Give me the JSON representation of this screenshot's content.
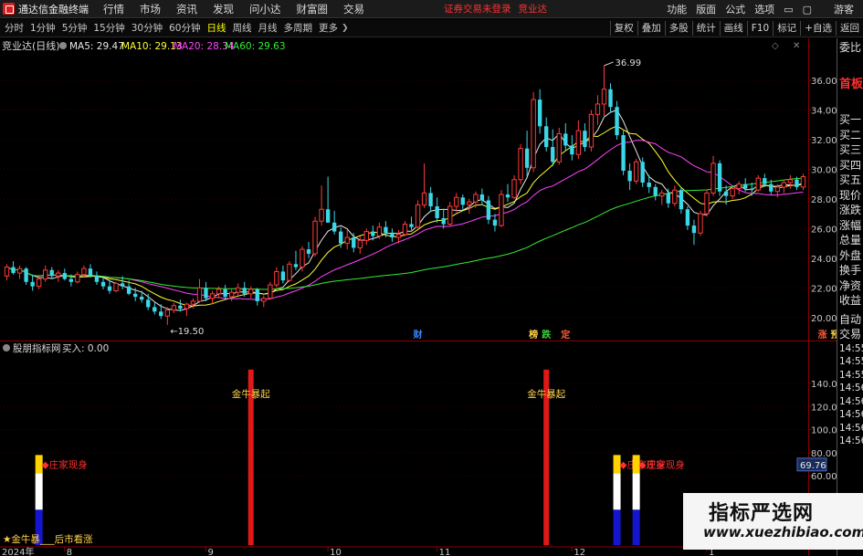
{
  "menubar": {
    "app_title": "通达信金融终端",
    "items": [
      "行情",
      "市场",
      "资讯",
      "发现",
      "问小达",
      "财富圈",
      "交易"
    ],
    "warning": "证券交易未登录",
    "warning_link": "竞业达",
    "right_items": [
      "功能",
      "版面",
      "公式",
      "选项"
    ],
    "user": "游客"
  },
  "toolbar": {
    "periods": [
      "分时",
      "1分钟",
      "5分钟",
      "15分钟",
      "30分钟",
      "60分钟",
      "日线",
      "周线",
      "月线",
      "多周期",
      "更多"
    ],
    "active_period": "日线",
    "right_buttons": [
      "复权",
      "叠加",
      "多股",
      "统计",
      "画线",
      "F10",
      "标记",
      "+自选",
      "返回"
    ]
  },
  "stock": {
    "title": "竞业达(日线)",
    "ma": [
      {
        "label": "MA5: 29.47",
        "color": "#e8e8e8"
      },
      {
        "label": "MA10: 29.13",
        "color": "#ffff33"
      },
      {
        "label": "MA20: 28.34",
        "color": "#ff44ff"
      },
      {
        "label": "MA60: 29.63",
        "color": "#33ee33"
      }
    ],
    "high_label": "36.99",
    "low_label": "19.50"
  },
  "event_marks": [
    {
      "label": "财",
      "color": "#3b82f6",
      "index": 64
    },
    {
      "label": "榜",
      "color": "#ffd24a",
      "index": 82
    },
    {
      "label": "跌",
      "color": "#3bd13b",
      "index": 84
    },
    {
      "label": "定",
      "color": "#ff5a3b",
      "index": 87
    },
    {
      "label": "涨",
      "color": "#ff5a3b",
      "index": 127
    },
    {
      "label": "预",
      "color": "#ffd24a",
      "index": 129
    }
  ],
  "indicator": {
    "title": "股朋指标网",
    "value_label": "买入: 0.00",
    "signal_labels": [
      "金牛暴起",
      "金牛暴起"
    ],
    "dealer_labels": [
      "◆庄家现身",
      "◆庄家现身",
      "◆庄家现身"
    ],
    "bottom_note": "★金牛暴___后市看涨",
    "current_value_tag": "69.76"
  },
  "chart_data": {
    "type": "candlestick",
    "price_axis": {
      "ticks": [
        20.0,
        22.0,
        24.0,
        26.0,
        28.0,
        30.0,
        32.0,
        34.0,
        36.0
      ],
      "range": [
        19.0,
        37.6
      ]
    },
    "indicator_axis": {
      "ticks": [
        60.0,
        80.0,
        100.0,
        120.0,
        140.0
      ],
      "range": [
        0,
        155
      ]
    },
    "x_labels": [
      {
        "label": "2024年",
        "index": 0
      },
      {
        "label": "8",
        "index": 9
      },
      {
        "label": "9",
        "index": 31
      },
      {
        "label": "10",
        "index": 50
      },
      {
        "label": "11",
        "index": 67
      },
      {
        "label": "12",
        "index": 88
      },
      {
        "label": "1",
        "index": 109
      }
    ],
    "candles": [
      [
        22.8,
        23.6,
        22.5,
        23.4
      ],
      [
        23.4,
        23.8,
        22.9,
        23.0
      ],
      [
        23.0,
        23.5,
        22.6,
        23.3
      ],
      [
        23.3,
        23.4,
        22.2,
        22.4
      ],
      [
        22.4,
        22.9,
        21.8,
        22.1
      ],
      [
        22.1,
        22.8,
        21.9,
        22.6
      ],
      [
        22.6,
        23.5,
        22.4,
        23.2
      ],
      [
        23.2,
        23.4,
        22.6,
        22.8
      ],
      [
        22.8,
        23.2,
        22.4,
        23.0
      ],
      [
        23.0,
        23.3,
        22.5,
        22.6
      ],
      [
        22.6,
        22.9,
        22.1,
        22.4
      ],
      [
        22.4,
        23.1,
        22.3,
        22.9
      ],
      [
        22.9,
        23.5,
        22.7,
        23.3
      ],
      [
        23.3,
        23.6,
        22.7,
        22.8
      ],
      [
        22.8,
        23.1,
        22.2,
        22.4
      ],
      [
        22.4,
        22.7,
        21.9,
        22.1
      ],
      [
        22.1,
        22.5,
        21.6,
        21.8
      ],
      [
        21.8,
        22.4,
        21.7,
        22.3
      ],
      [
        22.3,
        22.8,
        21.9,
        22.1
      ],
      [
        22.1,
        22.5,
        21.5,
        21.6
      ],
      [
        21.6,
        22.0,
        21.1,
        21.4
      ],
      [
        21.4,
        21.8,
        21.0,
        21.2
      ],
      [
        21.2,
        21.6,
        20.5,
        20.7
      ],
      [
        20.7,
        21.0,
        20.2,
        20.4
      ],
      [
        20.4,
        20.9,
        19.9,
        20.1
      ],
      [
        20.1,
        20.7,
        19.5,
        20.5
      ],
      [
        20.5,
        21.0,
        20.3,
        20.8
      ],
      [
        20.8,
        21.2,
        20.4,
        20.6
      ],
      [
        20.6,
        21.0,
        20.1,
        20.9
      ],
      [
        20.9,
        21.3,
        20.6,
        21.1
      ],
      [
        21.1,
        22.6,
        21.0,
        22.0
      ],
      [
        22.0,
        22.4,
        21.1,
        21.3
      ],
      [
        21.3,
        21.8,
        20.9,
        21.6
      ],
      [
        21.6,
        22.1,
        21.3,
        21.9
      ],
      [
        21.9,
        22.2,
        21.2,
        21.4
      ],
      [
        21.4,
        21.9,
        21.1,
        21.7
      ],
      [
        21.7,
        22.3,
        21.5,
        22.0
      ],
      [
        22.0,
        22.4,
        21.4,
        21.6
      ],
      [
        21.6,
        22.1,
        21.3,
        21.9
      ],
      [
        21.9,
        22.0,
        20.8,
        21.1
      ],
      [
        21.1,
        21.5,
        20.7,
        21.3
      ],
      [
        21.3,
        22.4,
        21.2,
        22.2
      ],
      [
        22.2,
        23.4,
        22.0,
        23.1
      ],
      [
        23.1,
        23.5,
        22.3,
        22.5
      ],
      [
        22.5,
        23.8,
        22.4,
        23.6
      ],
      [
        23.6,
        24.5,
        23.2,
        23.4
      ],
      [
        23.4,
        24.8,
        23.1,
        24.6
      ],
      [
        24.6,
        25.1,
        24.0,
        24.3
      ],
      [
        24.3,
        26.8,
        24.1,
        26.5
      ],
      [
        26.5,
        28.9,
        26.2,
        27.3
      ],
      [
        27.3,
        29.5,
        26.8,
        26.4
      ],
      [
        26.4,
        27.2,
        25.6,
        25.8
      ],
      [
        25.8,
        26.1,
        24.7,
        25.0
      ],
      [
        25.0,
        25.9,
        24.6,
        25.4
      ],
      [
        25.4,
        25.7,
        24.4,
        24.7
      ],
      [
        24.7,
        25.5,
        24.3,
        25.2
      ],
      [
        25.2,
        26.0,
        24.9,
        25.8
      ],
      [
        25.8,
        26.2,
        25.2,
        25.5
      ],
      [
        25.5,
        26.4,
        25.3,
        26.1
      ],
      [
        26.1,
        26.5,
        25.4,
        25.7
      ],
      [
        25.7,
        26.0,
        25.1,
        25.4
      ],
      [
        25.4,
        25.9,
        25.0,
        25.6
      ],
      [
        25.6,
        26.5,
        25.5,
        26.3
      ],
      [
        26.3,
        26.8,
        25.9,
        26.1
      ],
      [
        26.1,
        27.9,
        26.0,
        27.6
      ],
      [
        27.6,
        30.4,
        27.4,
        28.4
      ],
      [
        28.4,
        28.8,
        27.2,
        27.5
      ],
      [
        27.5,
        28.1,
        26.4,
        26.7
      ],
      [
        26.7,
        27.3,
        26.0,
        26.3
      ],
      [
        26.3,
        27.8,
        26.2,
        27.5
      ],
      [
        27.5,
        28.4,
        27.1,
        28.1
      ],
      [
        28.1,
        28.3,
        27.3,
        27.6
      ],
      [
        27.6,
        28.0,
        27.0,
        27.8
      ],
      [
        27.8,
        28.5,
        27.4,
        28.3
      ],
      [
        28.3,
        28.7,
        27.6,
        27.9
      ],
      [
        27.9,
        28.2,
        26.3,
        26.6
      ],
      [
        26.6,
        27.0,
        25.8,
        26.2
      ],
      [
        26.2,
        28.6,
        26.1,
        28.3
      ],
      [
        28.3,
        29.0,
        27.8,
        28.1
      ],
      [
        28.1,
        29.6,
        28.0,
        29.3
      ],
      [
        29.3,
        31.7,
        29.0,
        31.4
      ],
      [
        31.4,
        32.6,
        29.5,
        30.1
      ],
      [
        30.1,
        35.2,
        29.8,
        34.7
      ],
      [
        34.7,
        35.4,
        32.4,
        32.9
      ],
      [
        32.9,
        33.5,
        31.2,
        31.5
      ],
      [
        31.5,
        32.7,
        30.2,
        30.5
      ],
      [
        30.5,
        32.8,
        30.3,
        32.4
      ],
      [
        32.4,
        33.1,
        31.2,
        31.6
      ],
      [
        31.6,
        32.3,
        30.6,
        31.0
      ],
      [
        31.0,
        33.3,
        30.7,
        32.6
      ],
      [
        32.6,
        33.1,
        31.2,
        31.5
      ],
      [
        31.5,
        34.0,
        31.2,
        33.7
      ],
      [
        33.7,
        35.0,
        33.0,
        34.4
      ],
      [
        34.4,
        36.99,
        33.6,
        35.4
      ],
      [
        35.4,
        35.8,
        33.8,
        34.2
      ],
      [
        34.2,
        34.6,
        32.0,
        32.3
      ],
      [
        32.3,
        32.6,
        29.6,
        29.9
      ],
      [
        29.9,
        30.4,
        28.6,
        29.2
      ],
      [
        29.2,
        30.7,
        29.0,
        30.5
      ],
      [
        30.5,
        30.8,
        28.8,
        29.1
      ],
      [
        29.1,
        29.6,
        28.4,
        28.8
      ],
      [
        28.8,
        29.0,
        27.9,
        28.2
      ],
      [
        28.2,
        28.6,
        27.6,
        28.4
      ],
      [
        28.4,
        28.7,
        27.4,
        27.7
      ],
      [
        27.7,
        28.9,
        27.5,
        28.6
      ],
      [
        28.6,
        28.8,
        27.0,
        27.3
      ],
      [
        27.3,
        27.5,
        25.9,
        26.2
      ],
      [
        26.2,
        26.6,
        24.9,
        25.7
      ],
      [
        25.7,
        27.2,
        25.5,
        27.0
      ],
      [
        27.0,
        28.6,
        26.8,
        28.4
      ],
      [
        28.4,
        30.9,
        28.2,
        30.4
      ],
      [
        30.4,
        30.6,
        28.2,
        28.5
      ],
      [
        28.5,
        28.9,
        27.6,
        28.2
      ],
      [
        28.2,
        28.8,
        28.0,
        28.7
      ],
      [
        28.7,
        29.2,
        28.3,
        29.0
      ],
      [
        29.0,
        29.4,
        28.5,
        28.7
      ],
      [
        28.7,
        29.1,
        28.2,
        28.6
      ],
      [
        28.6,
        29.6,
        28.5,
        29.4
      ],
      [
        29.4,
        29.7,
        28.8,
        29.0
      ],
      [
        29.0,
        29.3,
        28.3,
        28.5
      ],
      [
        28.5,
        29.0,
        28.1,
        28.8
      ],
      [
        28.8,
        29.3,
        28.4,
        29.1
      ],
      [
        29.1,
        29.6,
        28.7,
        29.3
      ],
      [
        29.3,
        29.5,
        28.6,
        28.8
      ],
      [
        28.8,
        29.7,
        28.6,
        29.5
      ]
    ],
    "signals": {
      "big_red_bars": [
        {
          "index": 38,
          "value": 152
        },
        {
          "index": 84,
          "value": 152
        }
      ],
      "dealer_bars": [
        {
          "index": 5,
          "value": 60
        },
        {
          "index": 95,
          "value": 60
        },
        {
          "index": 98,
          "value": 60
        }
      ]
    }
  }
}
